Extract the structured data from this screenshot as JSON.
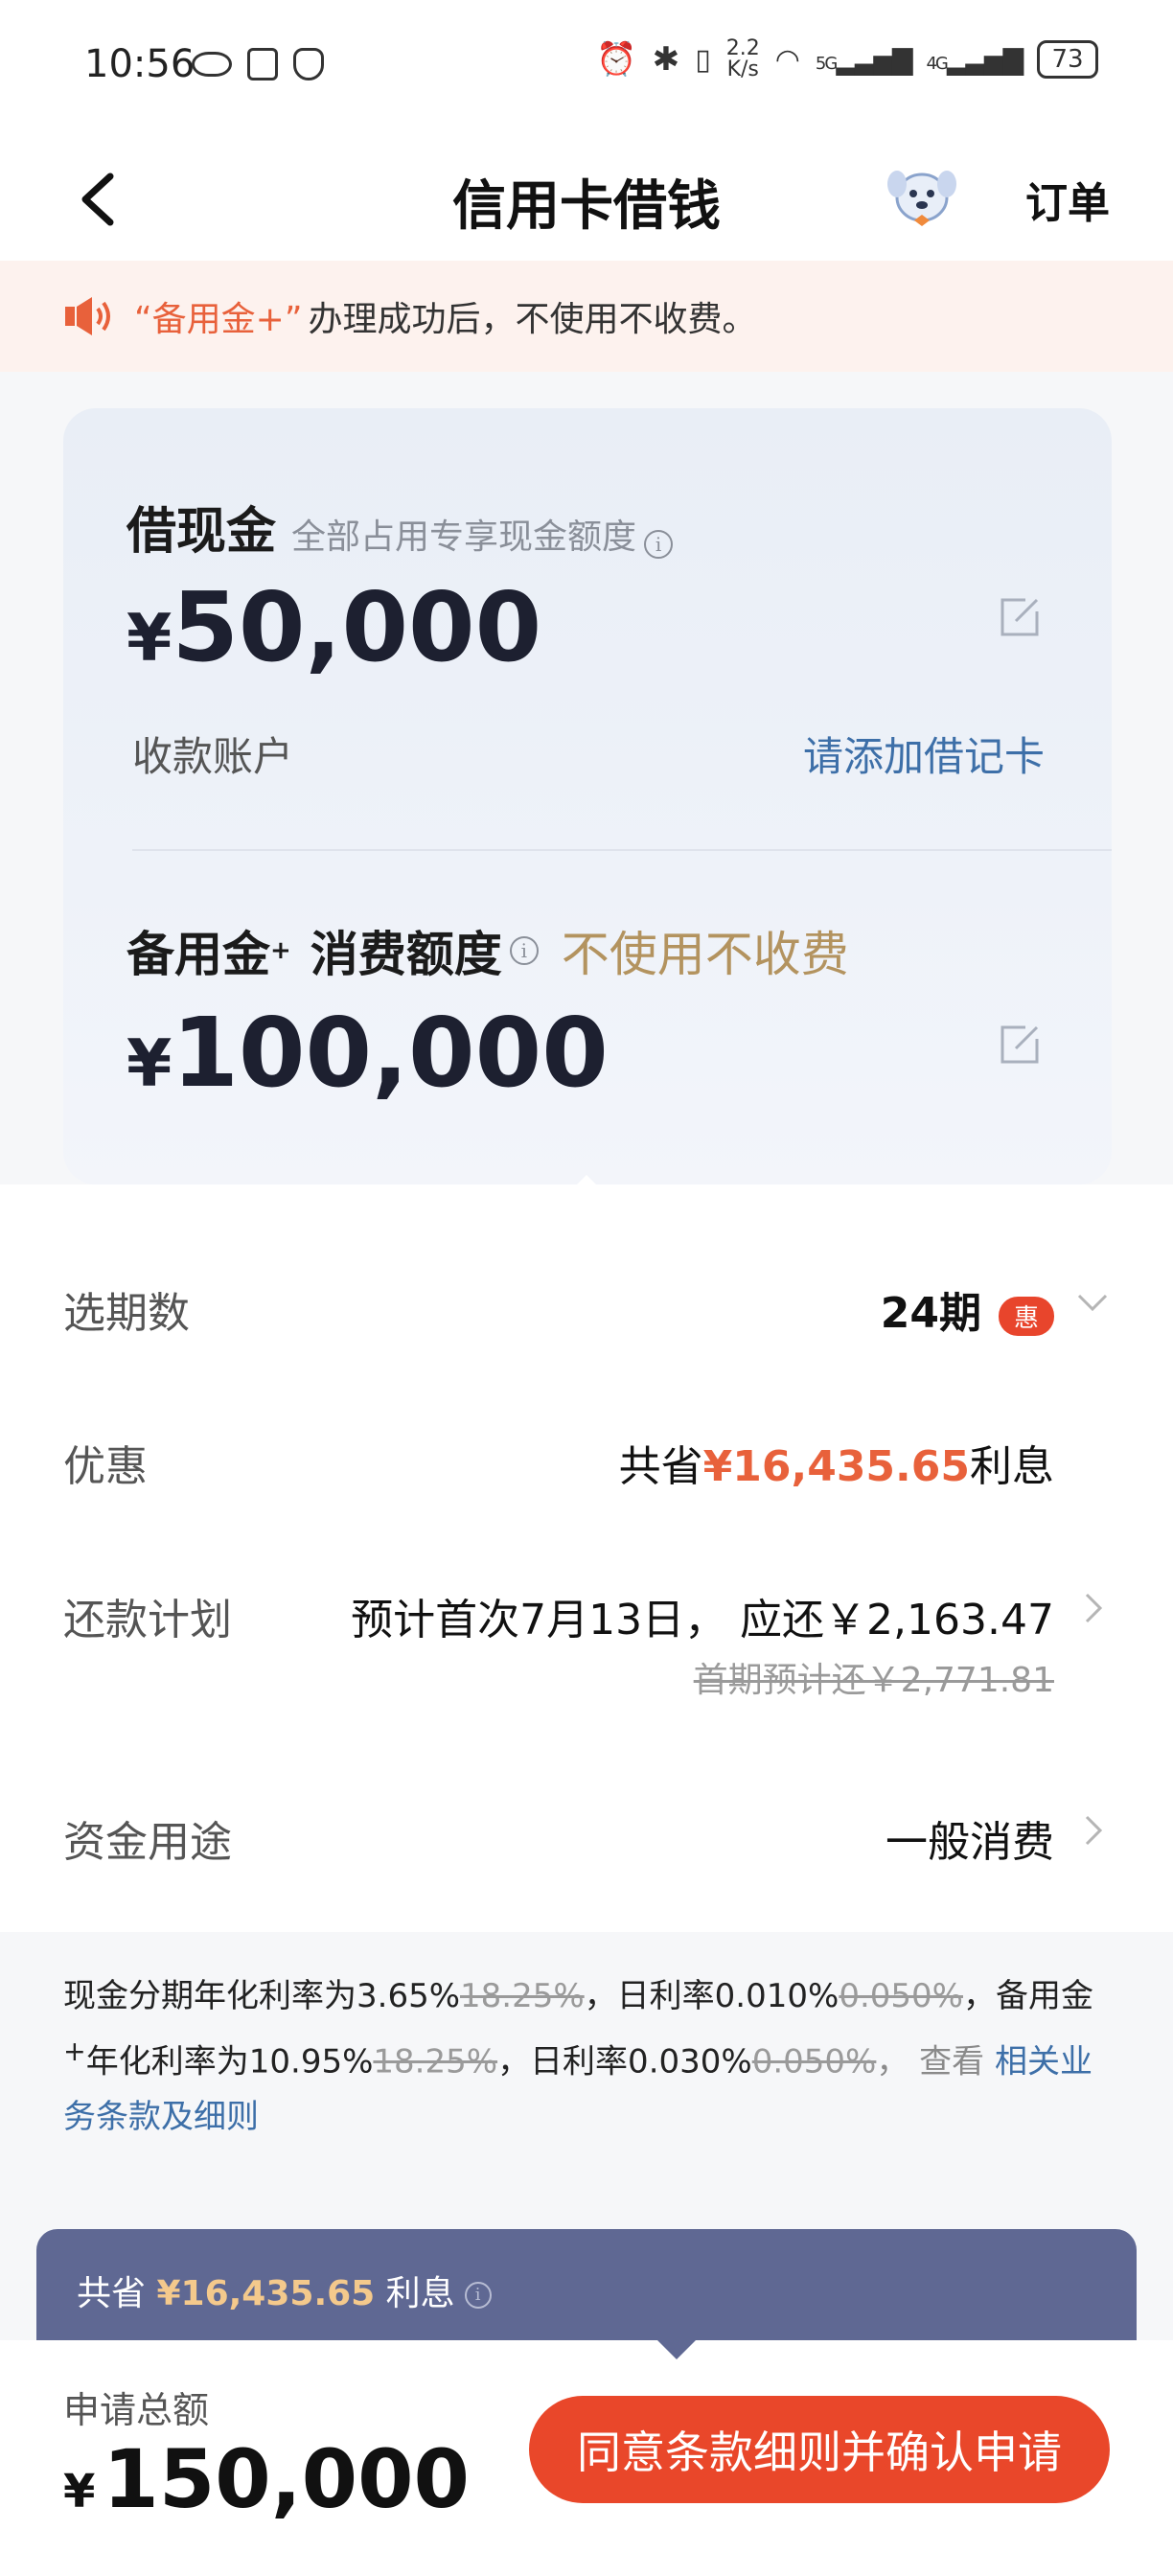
{
  "status_bar": {
    "time": "10:56",
    "speed_value": "2.2",
    "speed_unit": "K/s",
    "network": "5G",
    "network2": "4G",
    "battery": "73"
  },
  "nav": {
    "title": "信用卡借钱",
    "order": "订单"
  },
  "notice": {
    "highlight": "“备用金+”",
    "text": "办理成功后，不使用不收费。"
  },
  "card": {
    "cash": {
      "label": "借现金",
      "sublabel": "全部占用专享现金额度",
      "currency": "¥",
      "amount": "50,000"
    },
    "receive": {
      "label": "收款账户",
      "link": "请添加借记卡"
    },
    "reserve": {
      "label": "备用金",
      "sup": "+",
      "label2": "消费额度",
      "tag": "不使用不收费",
      "currency": "¥",
      "amount": "100,000"
    }
  },
  "options": {
    "term": {
      "label": "选期数",
      "value": "24期",
      "badge": "惠"
    },
    "discount": {
      "label": "优惠",
      "prefix": "共省",
      "amount": "¥16,435.65",
      "suffix": "利息"
    },
    "plan": {
      "label": "还款计划",
      "value": "预计首次7月13日， 应还￥2,163.47",
      "original": "首期预计还￥2,771.81"
    },
    "purpose": {
      "label": "资金用途",
      "value": "一般消费"
    }
  },
  "terms": {
    "p1": "现金分期年化利率为3.65%",
    "s1": "18.25%",
    "p2": "，日利率0.010%",
    "s2": "0.050%",
    "p3": "，备用金",
    "sup": "+",
    "p4": "年化利率为10.95%",
    "s3": "18.25%",
    "p5": "，日利率0.030%",
    "s4": "0.050%",
    "p6": "， 查看 ",
    "link": "相关业务条款及细则"
  },
  "savings": {
    "prefix": "共省",
    "amount": "¥16,435.65",
    "suffix": "利息"
  },
  "bottom": {
    "total_label": "申请总额",
    "currency": "¥",
    "total": "150,000",
    "confirm": "同意条款细则并确认申请"
  },
  "colors": {
    "accent": "#e9472a",
    "discount": "#e8613b",
    "link": "#3d6fa8",
    "gold": "#b3935f",
    "banner": "#5f6893"
  }
}
